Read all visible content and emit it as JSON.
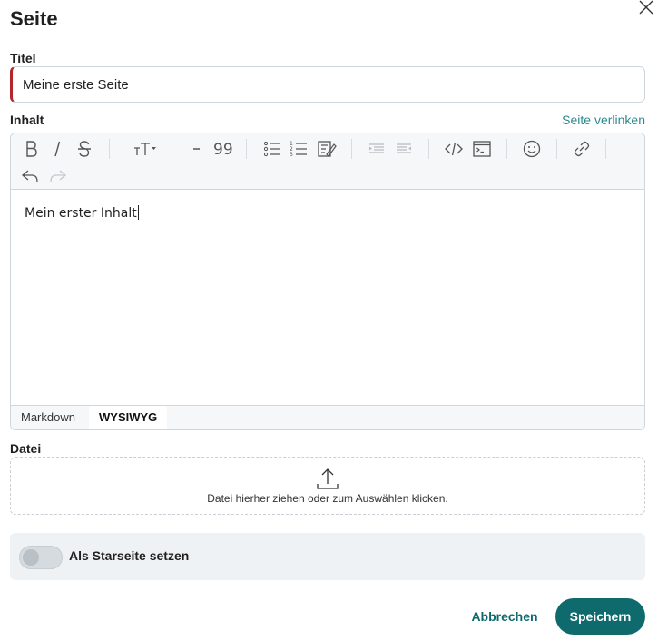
{
  "dialog": {
    "title": "Seite",
    "close_icon": "close-icon"
  },
  "title_field": {
    "label": "Titel",
    "value": "Meine erste Seite"
  },
  "content_field": {
    "label": "Inhalt",
    "link_page": "Seite verlinken",
    "body_text": "Mein erster Inhalt",
    "toolbar_icons": [
      "bold-icon",
      "italic-icon",
      "strikethrough-icon",
      "text-size-icon",
      "horizontal-rule-icon",
      "quote-icon",
      "bullet-list-icon",
      "numbered-list-icon",
      "task-list-icon",
      "indent-icon",
      "outdent-icon",
      "code-icon",
      "code-block-icon",
      "emoji-icon",
      "link-icon",
      "undo-icon",
      "redo-icon"
    ],
    "modes": [
      "Markdown",
      "WYSIWYG"
    ],
    "active_mode": "WYSIWYG"
  },
  "file_field": {
    "label": "Datei",
    "dropzone_text": "Datei hierher ziehen oder zum Auswählen klicken.",
    "icon": "upload-icon"
  },
  "start_page": {
    "label": "Als Starseite setzen",
    "enabled": false
  },
  "actions": {
    "cancel": "Abbrechen",
    "save": "Speichern"
  },
  "colors": {
    "primary": "#0f6a6e",
    "link": "#2b8a8f",
    "required_marker": "#b3262c"
  }
}
